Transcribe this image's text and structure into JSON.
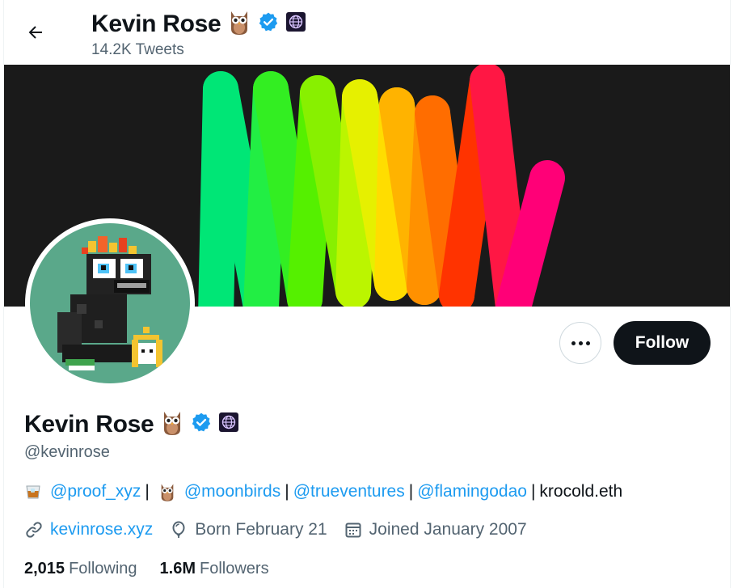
{
  "header": {
    "name": "Kevin Rose",
    "tweets": "14.2K Tweets"
  },
  "profile": {
    "name": "Kevin Rose",
    "handle": "@kevinrose",
    "bio": {
      "proof": "@proof_xyz",
      "moonbirds": "@moonbirds",
      "trueventures": "@trueventures",
      "flamingodao": "@flamingodao",
      "ens": "krocold.eth",
      "separator": "|"
    },
    "website": "kevinrose.xyz",
    "birthday": "Born February 21",
    "joined": "Joined January 2007",
    "following_count": "2,015",
    "following_label": "Following",
    "followers_count": "1.6M",
    "followers_label": "Followers"
  },
  "actions": {
    "follow_label": "Follow"
  },
  "icons": {
    "back": "back-arrow-icon",
    "owl": "owl-icon",
    "verified": "verified-badge-icon",
    "globe": "globe-icon",
    "whiskey": "whiskey-glass-icon",
    "link": "link-icon",
    "balloon": "balloon-icon",
    "calendar": "calendar-icon"
  },
  "colors": {
    "accent": "#1d9bf0",
    "text": "#0f1419",
    "muted": "#536471",
    "follow_bg": "#0f1419"
  }
}
